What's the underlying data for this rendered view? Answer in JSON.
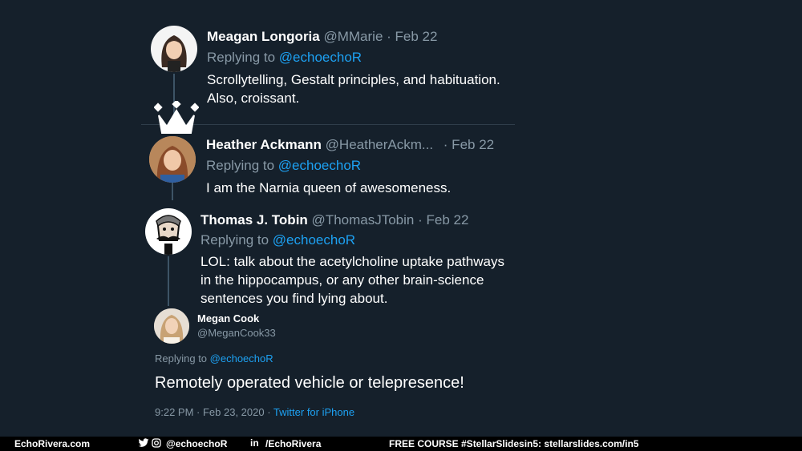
{
  "tweets": [
    {
      "name": "Meagan Longoria",
      "handle": "@MMarie",
      "date": "· Feb 22",
      "replying_prefix": "Replying to",
      "replying_handle": "@echoechoR",
      "text_lines": [
        "Scrollytelling, Gestalt principles, and habituation.",
        "Also, croissant."
      ]
    },
    {
      "name": "Heather Ackmann",
      "handle": "@HeatherAckm...",
      "date": "· Feb 22",
      "replying_prefix": "Replying to",
      "replying_handle": "@echoechoR",
      "text_lines": [
        "I am the Narnia queen of awesomeness."
      ]
    },
    {
      "name": "Thomas J. Tobin",
      "handle": "@ThomasJTobin",
      "date": "· Feb 22",
      "replying_prefix": "Replying to",
      "replying_handle": "@echoechoR",
      "text_lines": [
        "LOL: talk about the acetylcholine uptake pathways",
        "in the hippocampus, or any other brain-science",
        "sentences you find lying about."
      ]
    }
  ],
  "main_tweet": {
    "name": "Megan Cook",
    "handle": "@MeganCook33",
    "replying_prefix": "Replying to",
    "replying_handle": "@echoechoR",
    "text": "Remotely operated vehicle or telepresence!",
    "timestamp": "9:22 PM · Feb 23, 2020 ·",
    "source": "Twitter for iPhone"
  },
  "footer": {
    "site": "EchoRivera.com",
    "social_handle": "@echoechoR",
    "linkedin": "/EchoRivera",
    "promo": "FREE COURSE #StellarSlidesin5: stellarslides.com/in5"
  },
  "colors": {
    "background": "#15202b",
    "link": "#1da1f2",
    "muted": "#8899a6"
  }
}
